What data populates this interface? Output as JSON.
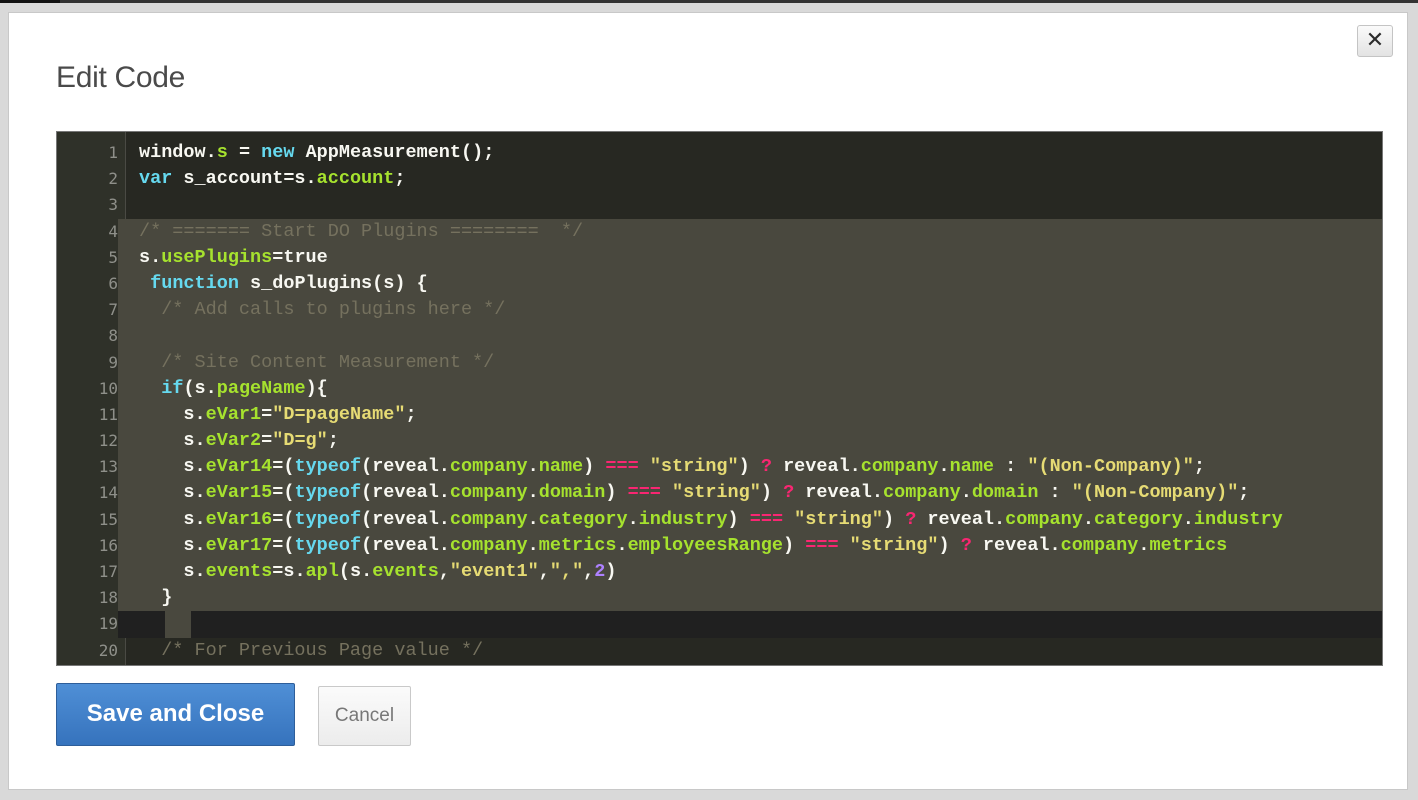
{
  "dialog": {
    "title": "Edit Code",
    "close_label": "✕",
    "save_label": "Save and Close",
    "cancel_label": "Cancel"
  },
  "colors": {
    "keyword": "#66d9ef",
    "identifier": "#f8f8f2",
    "property": "#a6e22e",
    "string": "#e6db74",
    "comment": "#75715e",
    "number": "#ae81ff",
    "operator": "#f92672",
    "selection": "#49483e",
    "editor_bg": "#272822",
    "save_button": "#3a78c2"
  },
  "editor": {
    "lines": [
      {
        "n": "1",
        "t": [
          [
            "window",
            "i"
          ],
          [
            ".",
            "i"
          ],
          [
            "s",
            "p"
          ],
          [
            " = ",
            "i"
          ],
          [
            "new",
            "k"
          ],
          [
            " AppMeasurement();",
            "i"
          ]
        ]
      },
      {
        "n": "2",
        "t": [
          [
            "var",
            "k"
          ],
          [
            " s_account=s.",
            "i"
          ],
          [
            "account",
            "p"
          ],
          [
            ";",
            "i"
          ]
        ]
      },
      {
        "n": "3",
        "t": []
      },
      {
        "n": "4",
        "sel": true,
        "t": [
          [
            "/* ======= Start DO Plugins ========  */",
            "c"
          ]
        ]
      },
      {
        "n": "5",
        "sel": true,
        "t": [
          [
            "s.",
            "i"
          ],
          [
            "usePlugins",
            "p"
          ],
          [
            "=true",
            "i"
          ]
        ]
      },
      {
        "n": "6",
        "sel": true,
        "t": [
          [
            " ",
            "i"
          ],
          [
            "function",
            "k"
          ],
          [
            " s_doPlugins(s) {",
            "i"
          ]
        ]
      },
      {
        "n": "7",
        "sel": true,
        "t": [
          [
            "  /* Add calls to plugins here */",
            "c"
          ]
        ]
      },
      {
        "n": "8",
        "sel": true,
        "t": []
      },
      {
        "n": "9",
        "sel": true,
        "t": [
          [
            "  /* Site Content Measurement */",
            "c"
          ]
        ]
      },
      {
        "n": "10",
        "sel": true,
        "t": [
          [
            "  ",
            "i"
          ],
          [
            "if",
            "k"
          ],
          [
            "(s.",
            "i"
          ],
          [
            "pageName",
            "p"
          ],
          [
            "){",
            "i"
          ]
        ]
      },
      {
        "n": "11",
        "sel": true,
        "t": [
          [
            "    s.",
            "i"
          ],
          [
            "eVar1",
            "p"
          ],
          [
            "=",
            "i"
          ],
          [
            "\"D=pageName\"",
            "s"
          ],
          [
            ";",
            "i"
          ]
        ]
      },
      {
        "n": "12",
        "sel": true,
        "t": [
          [
            "    s.",
            "i"
          ],
          [
            "eVar2",
            "p"
          ],
          [
            "=",
            "i"
          ],
          [
            "\"D=g\"",
            "s"
          ],
          [
            ";",
            "i"
          ]
        ]
      },
      {
        "n": "13",
        "sel": true,
        "t": [
          [
            "    s.",
            "i"
          ],
          [
            "eVar14",
            "p"
          ],
          [
            "=(",
            "i"
          ],
          [
            "typeof",
            "k"
          ],
          [
            "(reveal.",
            "i"
          ],
          [
            "company",
            "p"
          ],
          [
            ".",
            "i"
          ],
          [
            "name",
            "p"
          ],
          [
            ") ",
            "i"
          ],
          [
            "===",
            "o"
          ],
          [
            " ",
            "i"
          ],
          [
            "\"string\"",
            "s"
          ],
          [
            ") ",
            "i"
          ],
          [
            "?",
            "o"
          ],
          [
            " reveal.",
            "i"
          ],
          [
            "company",
            "p"
          ],
          [
            ".",
            "i"
          ],
          [
            "name",
            "p"
          ],
          [
            " : ",
            "i"
          ],
          [
            "\"(Non-Company)\"",
            "s"
          ],
          [
            ";",
            "i"
          ]
        ]
      },
      {
        "n": "14",
        "sel": true,
        "t": [
          [
            "    s.",
            "i"
          ],
          [
            "eVar15",
            "p"
          ],
          [
            "=(",
            "i"
          ],
          [
            "typeof",
            "k"
          ],
          [
            "(reveal.",
            "i"
          ],
          [
            "company",
            "p"
          ],
          [
            ".",
            "i"
          ],
          [
            "domain",
            "p"
          ],
          [
            ") ",
            "i"
          ],
          [
            "===",
            "o"
          ],
          [
            " ",
            "i"
          ],
          [
            "\"string\"",
            "s"
          ],
          [
            ") ",
            "i"
          ],
          [
            "?",
            "o"
          ],
          [
            " reveal.",
            "i"
          ],
          [
            "company",
            "p"
          ],
          [
            ".",
            "i"
          ],
          [
            "domain",
            "p"
          ],
          [
            " : ",
            "i"
          ],
          [
            "\"(Non-Company)\"",
            "s"
          ],
          [
            ";",
            "i"
          ]
        ]
      },
      {
        "n": "15",
        "sel": true,
        "t": [
          [
            "    s.",
            "i"
          ],
          [
            "eVar16",
            "p"
          ],
          [
            "=(",
            "i"
          ],
          [
            "typeof",
            "k"
          ],
          [
            "(reveal.",
            "i"
          ],
          [
            "company",
            "p"
          ],
          [
            ".",
            "i"
          ],
          [
            "category",
            "p"
          ],
          [
            ".",
            "i"
          ],
          [
            "industry",
            "p"
          ],
          [
            ") ",
            "i"
          ],
          [
            "===",
            "o"
          ],
          [
            " ",
            "i"
          ],
          [
            "\"string\"",
            "s"
          ],
          [
            ") ",
            "i"
          ],
          [
            "?",
            "o"
          ],
          [
            " reveal.",
            "i"
          ],
          [
            "company",
            "p"
          ],
          [
            ".",
            "i"
          ],
          [
            "category",
            "p"
          ],
          [
            ".",
            "i"
          ],
          [
            "industry",
            "p"
          ]
        ]
      },
      {
        "n": "16",
        "sel": true,
        "t": [
          [
            "    s.",
            "i"
          ],
          [
            "eVar17",
            "p"
          ],
          [
            "=(",
            "i"
          ],
          [
            "typeof",
            "k"
          ],
          [
            "(reveal.",
            "i"
          ],
          [
            "company",
            "p"
          ],
          [
            ".",
            "i"
          ],
          [
            "metrics",
            "p"
          ],
          [
            ".",
            "i"
          ],
          [
            "employeesRange",
            "p"
          ],
          [
            ") ",
            "i"
          ],
          [
            "===",
            "o"
          ],
          [
            " ",
            "i"
          ],
          [
            "\"string\"",
            "s"
          ],
          [
            ") ",
            "i"
          ],
          [
            "?",
            "o"
          ],
          [
            " reveal.",
            "i"
          ],
          [
            "company",
            "p"
          ],
          [
            ".",
            "i"
          ],
          [
            "metrics",
            "p"
          ]
        ]
      },
      {
        "n": "17",
        "sel": true,
        "t": [
          [
            "    s.",
            "i"
          ],
          [
            "events",
            "p"
          ],
          [
            "=s.",
            "i"
          ],
          [
            "apl",
            "p"
          ],
          [
            "(s.",
            "i"
          ],
          [
            "events",
            "p"
          ],
          [
            ",",
            "i"
          ],
          [
            "\"event1\"",
            "s"
          ],
          [
            ",",
            "i"
          ],
          [
            "\",\"",
            "s"
          ],
          [
            ",",
            "i"
          ],
          [
            "2",
            "n"
          ],
          [
            ")",
            "i"
          ]
        ]
      },
      {
        "n": "18",
        "sel": true,
        "t": [
          [
            "  }",
            "i"
          ]
        ]
      },
      {
        "n": "19",
        "cursor": true,
        "t": []
      },
      {
        "n": "20",
        "t": [
          [
            "  /* For Previous Page value */",
            "c"
          ]
        ]
      }
    ]
  }
}
